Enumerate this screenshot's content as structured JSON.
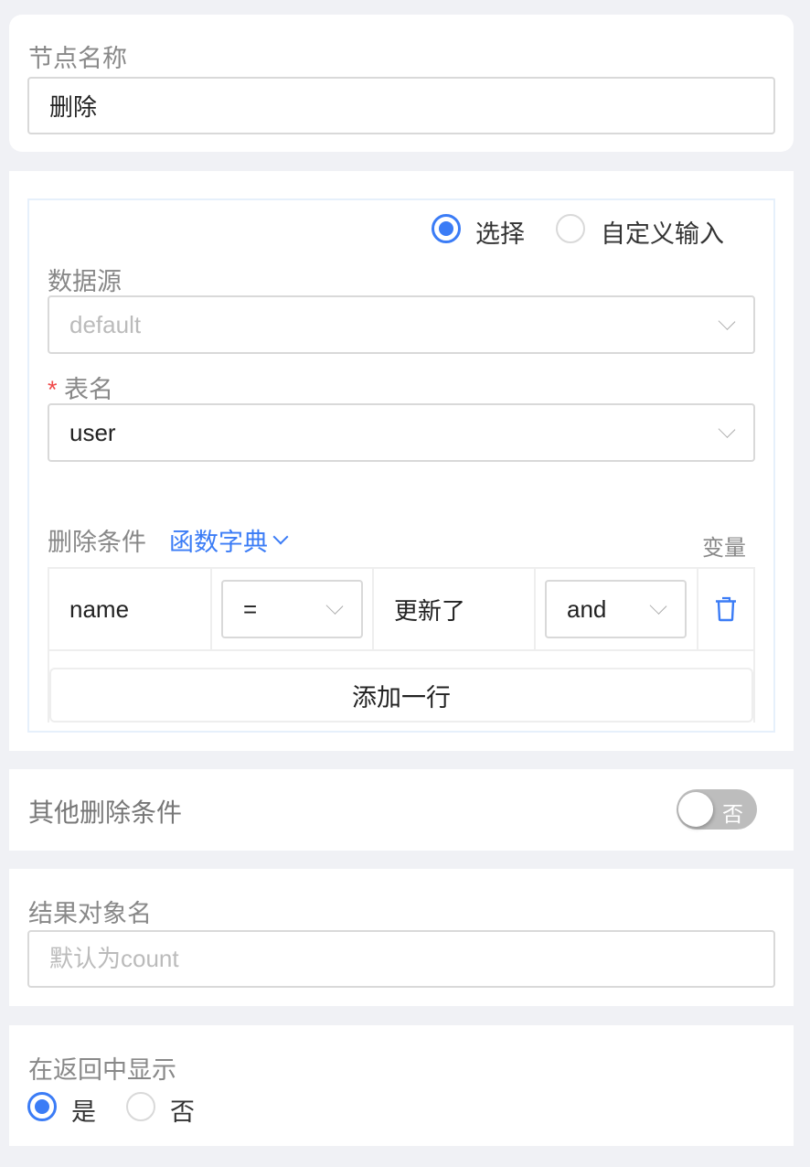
{
  "node_name": {
    "label": "节点名称",
    "value": "删除"
  },
  "source_mode": {
    "options": [
      {
        "label": "选择",
        "selected": true
      },
      {
        "label": "自定义输入",
        "selected": false
      }
    ]
  },
  "datasource": {
    "label": "数据源",
    "value": "default"
  },
  "table_name": {
    "required_mark": "*",
    "label": "表名",
    "value": "user"
  },
  "delete_conditions": {
    "label": "删除条件",
    "func_dict_label": "函数字典",
    "variable_label": "变量",
    "rows": [
      {
        "field": "name",
        "operator": "=",
        "value": "更新了",
        "logic": "and"
      }
    ],
    "add_row_label": "添加一行"
  },
  "other_conditions": {
    "label": "其他删除条件",
    "toggle_text": "否",
    "enabled": false
  },
  "result_name": {
    "label": "结果对象名",
    "placeholder": "默认为count"
  },
  "show_in_return": {
    "label": "在返回中显示",
    "options": [
      {
        "label": "是",
        "selected": true
      },
      {
        "label": "否",
        "selected": false
      }
    ]
  },
  "colors": {
    "accent": "#3b7cf6",
    "required": "#f04a4a",
    "label": "#888888",
    "background": "#f0f1f5"
  }
}
